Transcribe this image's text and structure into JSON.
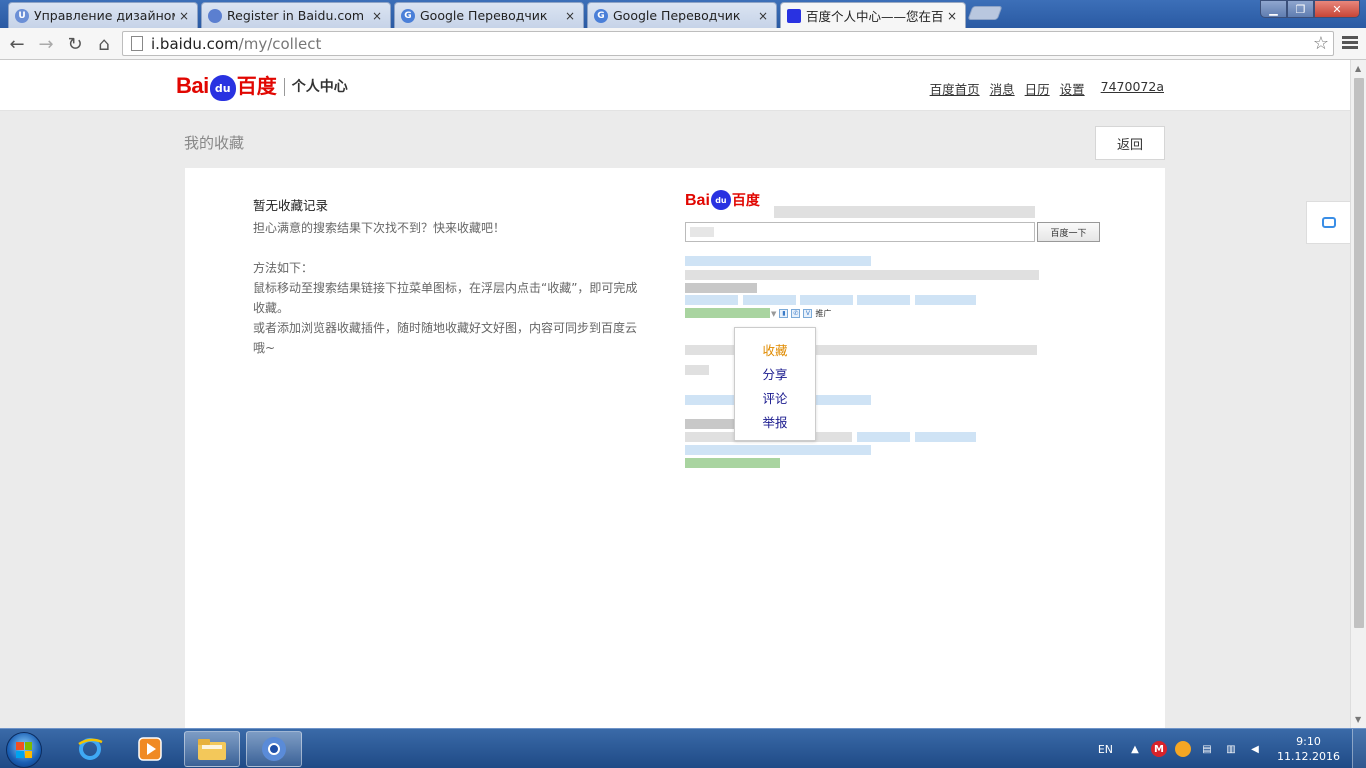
{
  "browser": {
    "tabs": [
      {
        "label": "Управление дизайном - ",
        "favicon": "U",
        "favicon_color": "#6b8fd6",
        "active": false
      },
      {
        "label": "Register in Baidu.com",
        "favicon": "",
        "favicon_color": "#5b7fd0",
        "active": false
      },
      {
        "label": "Google Переводчик",
        "favicon": "G",
        "favicon_color": "#4a7fd8",
        "active": false
      },
      {
        "label": "Google Переводчик",
        "favicon": "G",
        "favicon_color": "#4a7fd8",
        "active": false
      },
      {
        "label": "百度个人中心——您在百度",
        "favicon": "",
        "favicon_color": "#2932e1",
        "active": true
      }
    ],
    "close_glyph": "×",
    "url_host": "i.baidu.com",
    "url_path": "/my/collect"
  },
  "header": {
    "logo_bai": "Bai",
    "logo_du": "du",
    "logo_baidu_cn": "百度",
    "logo_section": "个人中心",
    "nav": [
      "百度首页",
      "消息",
      "日历",
      "设置"
    ],
    "username": "7470072a"
  },
  "page": {
    "title": "我的收藏",
    "back_label": "返回"
  },
  "empty_state": {
    "title": "暂无收藏记录",
    "line1": "担心满意的搜索结果下次找不到？快来收藏吧！",
    "method_heading": "方法如下：",
    "method1": "鼠标移动至搜索结果链接下拉菜单图标，在浮层内点击“收藏”，即可完成收藏。",
    "method2": "或者添加浏览器收藏插件，随时随地收藏好文好图，内容可同步到百度云哦~"
  },
  "illustration": {
    "search_button": "百度一下",
    "promo_label": "推广",
    "menu_items": [
      "收藏",
      "分享",
      "评论",
      "举报"
    ],
    "highlight_color": "#e08b00"
  },
  "taskbar": {
    "language": "EN",
    "time": "9:10",
    "date": "11.12.2016"
  }
}
